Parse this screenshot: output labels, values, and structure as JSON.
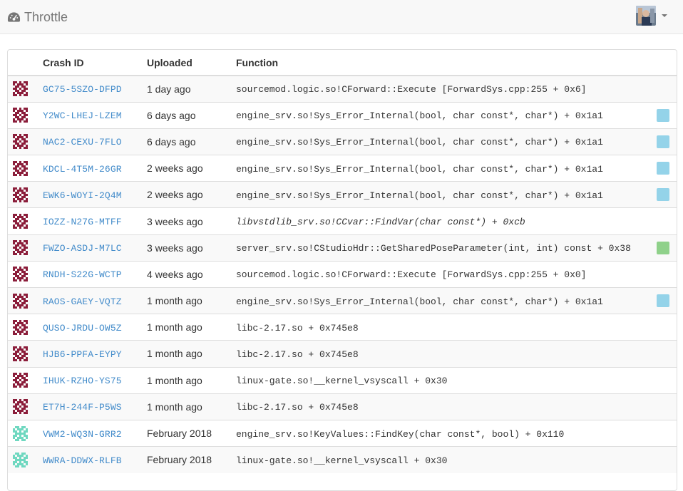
{
  "app": {
    "title": "Throttle"
  },
  "colors": {
    "badge_blue": "#94d3e9",
    "badge_green": "#8fd18a",
    "link": "#428bca"
  },
  "table": {
    "headers": {
      "crash_id": "Crash ID",
      "uploaded": "Uploaded",
      "function": "Function"
    },
    "rows": [
      {
        "identicon": "maroon",
        "crash_id": "GC75-5SZO-DFPD",
        "uploaded": "1 day ago",
        "function": "sourcemod.logic.so!CForward::Execute [ForwardSys.cpp:255 + 0x6]",
        "italic": false,
        "badge": ""
      },
      {
        "identicon": "maroon",
        "crash_id": "Y2WC-LHEJ-LZEM",
        "uploaded": "6 days ago",
        "function": "engine_srv.so!Sys_Error_Internal(bool, char const*, char*) + 0x1a1",
        "italic": false,
        "badge": "blue"
      },
      {
        "identicon": "maroon",
        "crash_id": "NAC2-CEXU-7FLO",
        "uploaded": "6 days ago",
        "function": "engine_srv.so!Sys_Error_Internal(bool, char const*, char*) + 0x1a1",
        "italic": false,
        "badge": "blue"
      },
      {
        "identicon": "maroon",
        "crash_id": "KDCL-4T5M-26GR",
        "uploaded": "2 weeks ago",
        "function": "engine_srv.so!Sys_Error_Internal(bool, char const*, char*) + 0x1a1",
        "italic": false,
        "badge": "blue"
      },
      {
        "identicon": "maroon",
        "crash_id": "EWK6-WOYI-2Q4M",
        "uploaded": "2 weeks ago",
        "function": "engine_srv.so!Sys_Error_Internal(bool, char const*, char*) + 0x1a1",
        "italic": false,
        "badge": "blue"
      },
      {
        "identicon": "maroon",
        "crash_id": "IOZZ-N27G-MTFF",
        "uploaded": "3 weeks ago",
        "function": "libvstdlib_srv.so!CCvar::FindVar(char const*) + 0xcb",
        "italic": true,
        "badge": ""
      },
      {
        "identicon": "maroon",
        "crash_id": "FWZO-ASDJ-M7LC",
        "uploaded": "3 weeks ago",
        "function": "server_srv.so!CStudioHdr::GetSharedPoseParameter(int, int) const + 0x38",
        "italic": false,
        "badge": "green"
      },
      {
        "identicon": "maroon",
        "crash_id": "RNDH-S22G-WCTP",
        "uploaded": "4 weeks ago",
        "function": "sourcemod.logic.so!CForward::Execute [ForwardSys.cpp:255 + 0x0]",
        "italic": false,
        "badge": ""
      },
      {
        "identicon": "maroon",
        "crash_id": "RAOS-GAEY-VQTZ",
        "uploaded": "1 month ago",
        "function": "engine_srv.so!Sys_Error_Internal(bool, char const*, char*) + 0x1a1",
        "italic": false,
        "badge": "blue"
      },
      {
        "identicon": "maroon",
        "crash_id": "QUSO-JRDU-OW5Z",
        "uploaded": "1 month ago",
        "function": "libc-2.17.so + 0x745e8",
        "italic": false,
        "badge": ""
      },
      {
        "identicon": "maroon",
        "crash_id": "HJB6-PPFA-EYPY",
        "uploaded": "1 month ago",
        "function": "libc-2.17.so + 0x745e8",
        "italic": false,
        "badge": ""
      },
      {
        "identicon": "maroon",
        "crash_id": "IHUK-RZHO-YS75",
        "uploaded": "1 month ago",
        "function": "linux-gate.so!__kernel_vsyscall + 0x30",
        "italic": false,
        "badge": ""
      },
      {
        "identicon": "maroon",
        "crash_id": "ET7H-244F-P5WS",
        "uploaded": "1 month ago",
        "function": "libc-2.17.so + 0x745e8",
        "italic": false,
        "badge": ""
      },
      {
        "identicon": "teal",
        "crash_id": "VWM2-WQ3N-GRR2",
        "uploaded": "February 2018",
        "function": "engine_srv.so!KeyValues::FindKey(char const*, bool) + 0x110",
        "italic": false,
        "badge": ""
      },
      {
        "identicon": "teal",
        "crash_id": "WWRA-DDWX-RLFB",
        "uploaded": "February 2018",
        "function": "linux-gate.so!__kernel_vsyscall + 0x30",
        "italic": false,
        "badge": ""
      }
    ]
  }
}
